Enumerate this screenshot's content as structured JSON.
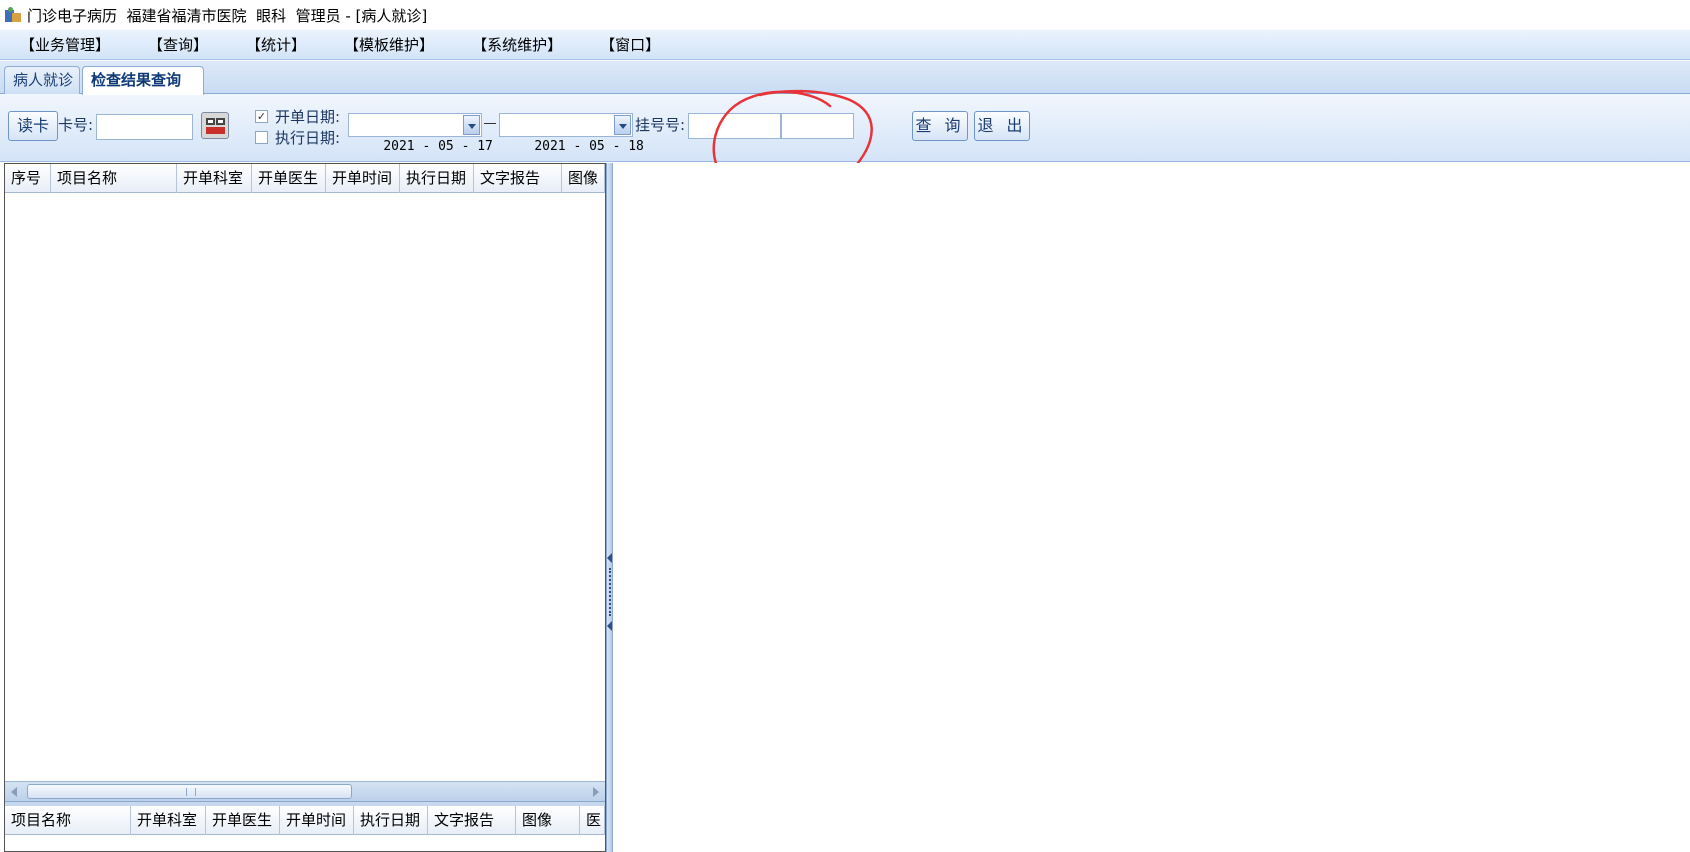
{
  "window": {
    "title": "门诊电子病历  福建省福清市医院  眼科  管理员 - [病人就诊]",
    "app_icon": "app-icon"
  },
  "menu": {
    "items": [
      "【业务管理】",
      "【查询】",
      "【统计】",
      "【模板维护】",
      "【系统维护】",
      "【窗口】"
    ]
  },
  "tabs": [
    {
      "label": "病人就诊",
      "active": false
    },
    {
      "label": "检查结果查询",
      "active": true
    }
  ],
  "toolbar": {
    "read_card_label": "读卡",
    "card_no_label": "卡号:",
    "card_no_value": "",
    "qr_icon": "qr-code-icon",
    "open_date_label": "开单日期:",
    "open_date_checked": true,
    "exec_date_label": "执行日期:",
    "exec_date_checked": false,
    "date_from": "2021 - 05 - 17",
    "date_to": "2021 - 05 - 18",
    "reg_no_label": "挂号号:",
    "reg_no_value_1": "",
    "reg_no_value_2": "",
    "query_label": "查 询",
    "exit_label": "退 出"
  },
  "grid_top": {
    "columns": [
      "序号",
      "项目名称",
      "开单科室",
      "开单医生",
      "开单时间",
      "执行日期",
      "文字报告",
      "图像"
    ],
    "rows": []
  },
  "grid_bottom": {
    "columns": [
      "项目名称",
      "开单科室",
      "开单医生",
      "开单时间",
      "执行日期",
      "文字报告",
      "图像",
      "医"
    ],
    "rows": []
  },
  "colors": {
    "annotation": "#e8333a",
    "accent": "#1c3f78"
  }
}
